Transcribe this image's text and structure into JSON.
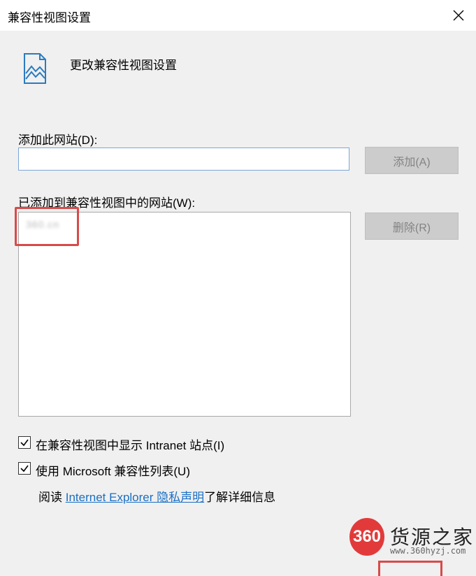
{
  "window": {
    "title": "兼容性视图设置"
  },
  "header": {
    "text": "更改兼容性视图设置",
    "icon": "page-image-icon"
  },
  "add_section": {
    "label": "添加此网站(D):",
    "input_value": "",
    "add_button": "添加(A)"
  },
  "list_section": {
    "label": "已添加到兼容性视图中的网站(W):",
    "items": [
      "360.cn"
    ],
    "remove_button": "删除(R)"
  },
  "options": {
    "intranet": {
      "label": "在兼容性视图中显示 Intranet 站点(I)",
      "checked": true
    },
    "ms_list": {
      "label": "使用 Microsoft 兼容性列表(U)",
      "checked": true
    }
  },
  "footer": {
    "read_prefix": "阅读 ",
    "link_text": "Internet Explorer 隐私声明",
    "read_suffix": "了解详细信息"
  },
  "watermark": {
    "logo": "360",
    "name": "货源之家",
    "url": "www.360hyzj.com"
  },
  "colors": {
    "highlight": "#d94a4a",
    "link": "#1a6fc4",
    "input_border": "#7aa7d6",
    "button_disabled_bg": "#cccccc"
  }
}
